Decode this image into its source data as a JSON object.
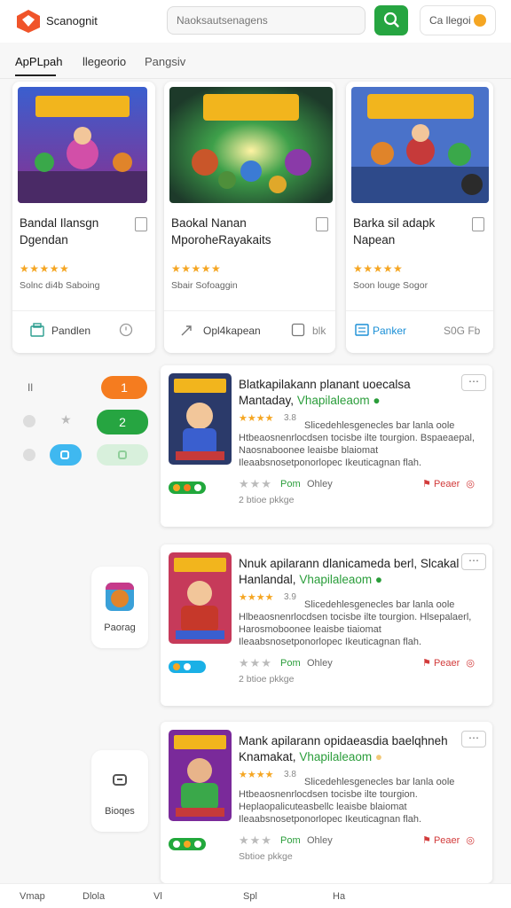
{
  "header": {
    "app_name": "Scanognit",
    "search_placeholder": "Naoksautsenagens",
    "user_label": "Ca llegoi"
  },
  "tabs": [
    {
      "label": "ApPLpah"
    },
    {
      "label": "llegeorio"
    },
    {
      "label": "Pangsiv"
    }
  ],
  "cards": [
    {
      "title": "Bandal Ilansgn Dgendan",
      "stars": "★★★★★",
      "meta": "Solnc di4b Saboing",
      "action_label": "Pandlen",
      "action_right": "",
      "art_text": "SOKNAK"
    },
    {
      "title": "Baokal Nanan MporoheRayakaits",
      "stars": "★★★★★",
      "meta": "Sbair Sofoaggin",
      "action_label": "Opl4kapean",
      "action_right": "blk",
      "art_text": "MAOK"
    },
    {
      "title": "Barka sil adapk Napean",
      "stars": "★★★★★",
      "meta": "Soon louge Sogor",
      "action_label": "Panker",
      "action_right": "S0G Fb",
      "art_text": "SMAGING"
    }
  ],
  "left_controls": {
    "row1_label": "Il",
    "pill1": "1",
    "pill2": "2",
    "side_tiles": [
      {
        "label": "Paorag"
      },
      {
        "label": "Bioqes"
      }
    ]
  },
  "list_items": [
    {
      "title": "Blatkapilakann planant uoecalsa Mantaday,",
      "developer": "Vhapilaleaom",
      "stars": "★★★★",
      "rating": "3.8",
      "description": "Slicedehlesgenecles bar lanla oole Htbeaosnenrlocdsen tocisbe ilte tourgion. Bspaeaepal, Naosnaboonee leaisbe blaiomat Ileaabsnosetponorlopec Ikeuticagnan flah.",
      "price": "Pom",
      "other": "Ohley",
      "report": "Peaer",
      "size": "2 btioe pkkge",
      "art_text": "ARBIN",
      "tag_color": "#22a83c"
    },
    {
      "title": "Nnuk apilarann dlanicameda berl, Slcakal Hanlandal,",
      "developer": "Vhapilaleaom",
      "stars": "★★★★",
      "rating": "3.9",
      "description": "Slicedehlesgenecles bar lanla oole Hlbeaosnenrlocdsen tocisbe ilte tourgion. Hlsepalaerl, Harosmoboonee leaisbe tiaiomat Ileaabsnosetponorlopec Ikeuticagnan flah.",
      "price": "Pom",
      "other": "Ohley",
      "report": "Peaer",
      "size": "2 btioe pkkge",
      "art_text": "SABZIK",
      "tag_color": "#1ab0e6"
    },
    {
      "title": "Mank apilarann opidaeasdia baelqhneh Knamakat,",
      "developer": "Vhapilaleaom",
      "stars": "★★★★",
      "rating": "3.8",
      "description": "Slicedehlesgenecles bar lanla oole Htbeaosnenrlocdsen tocisbe ilte tourgion. Heplaopalicuteasbellc leaisbe blaiomat Ileaabsnosetponorlopec Ikeuticagnan flah.",
      "price": "Pom",
      "other": "Ohley",
      "report": "Peaer",
      "size": "Sbtioe pkkge",
      "art_text": "SARRIS",
      "tag_color": "#22a83c"
    }
  ],
  "bottom_nav": [
    {
      "label": "Vmap"
    },
    {
      "label": "Dlola"
    },
    {
      "label": "Vl"
    },
    {
      "label": "Spl"
    },
    {
      "label": "Ha"
    }
  ],
  "colors": {
    "accent_green": "#26a541",
    "accent_orange": "#f57c1f",
    "star_gold": "#f5a623",
    "report_red": "#d23b3b"
  }
}
